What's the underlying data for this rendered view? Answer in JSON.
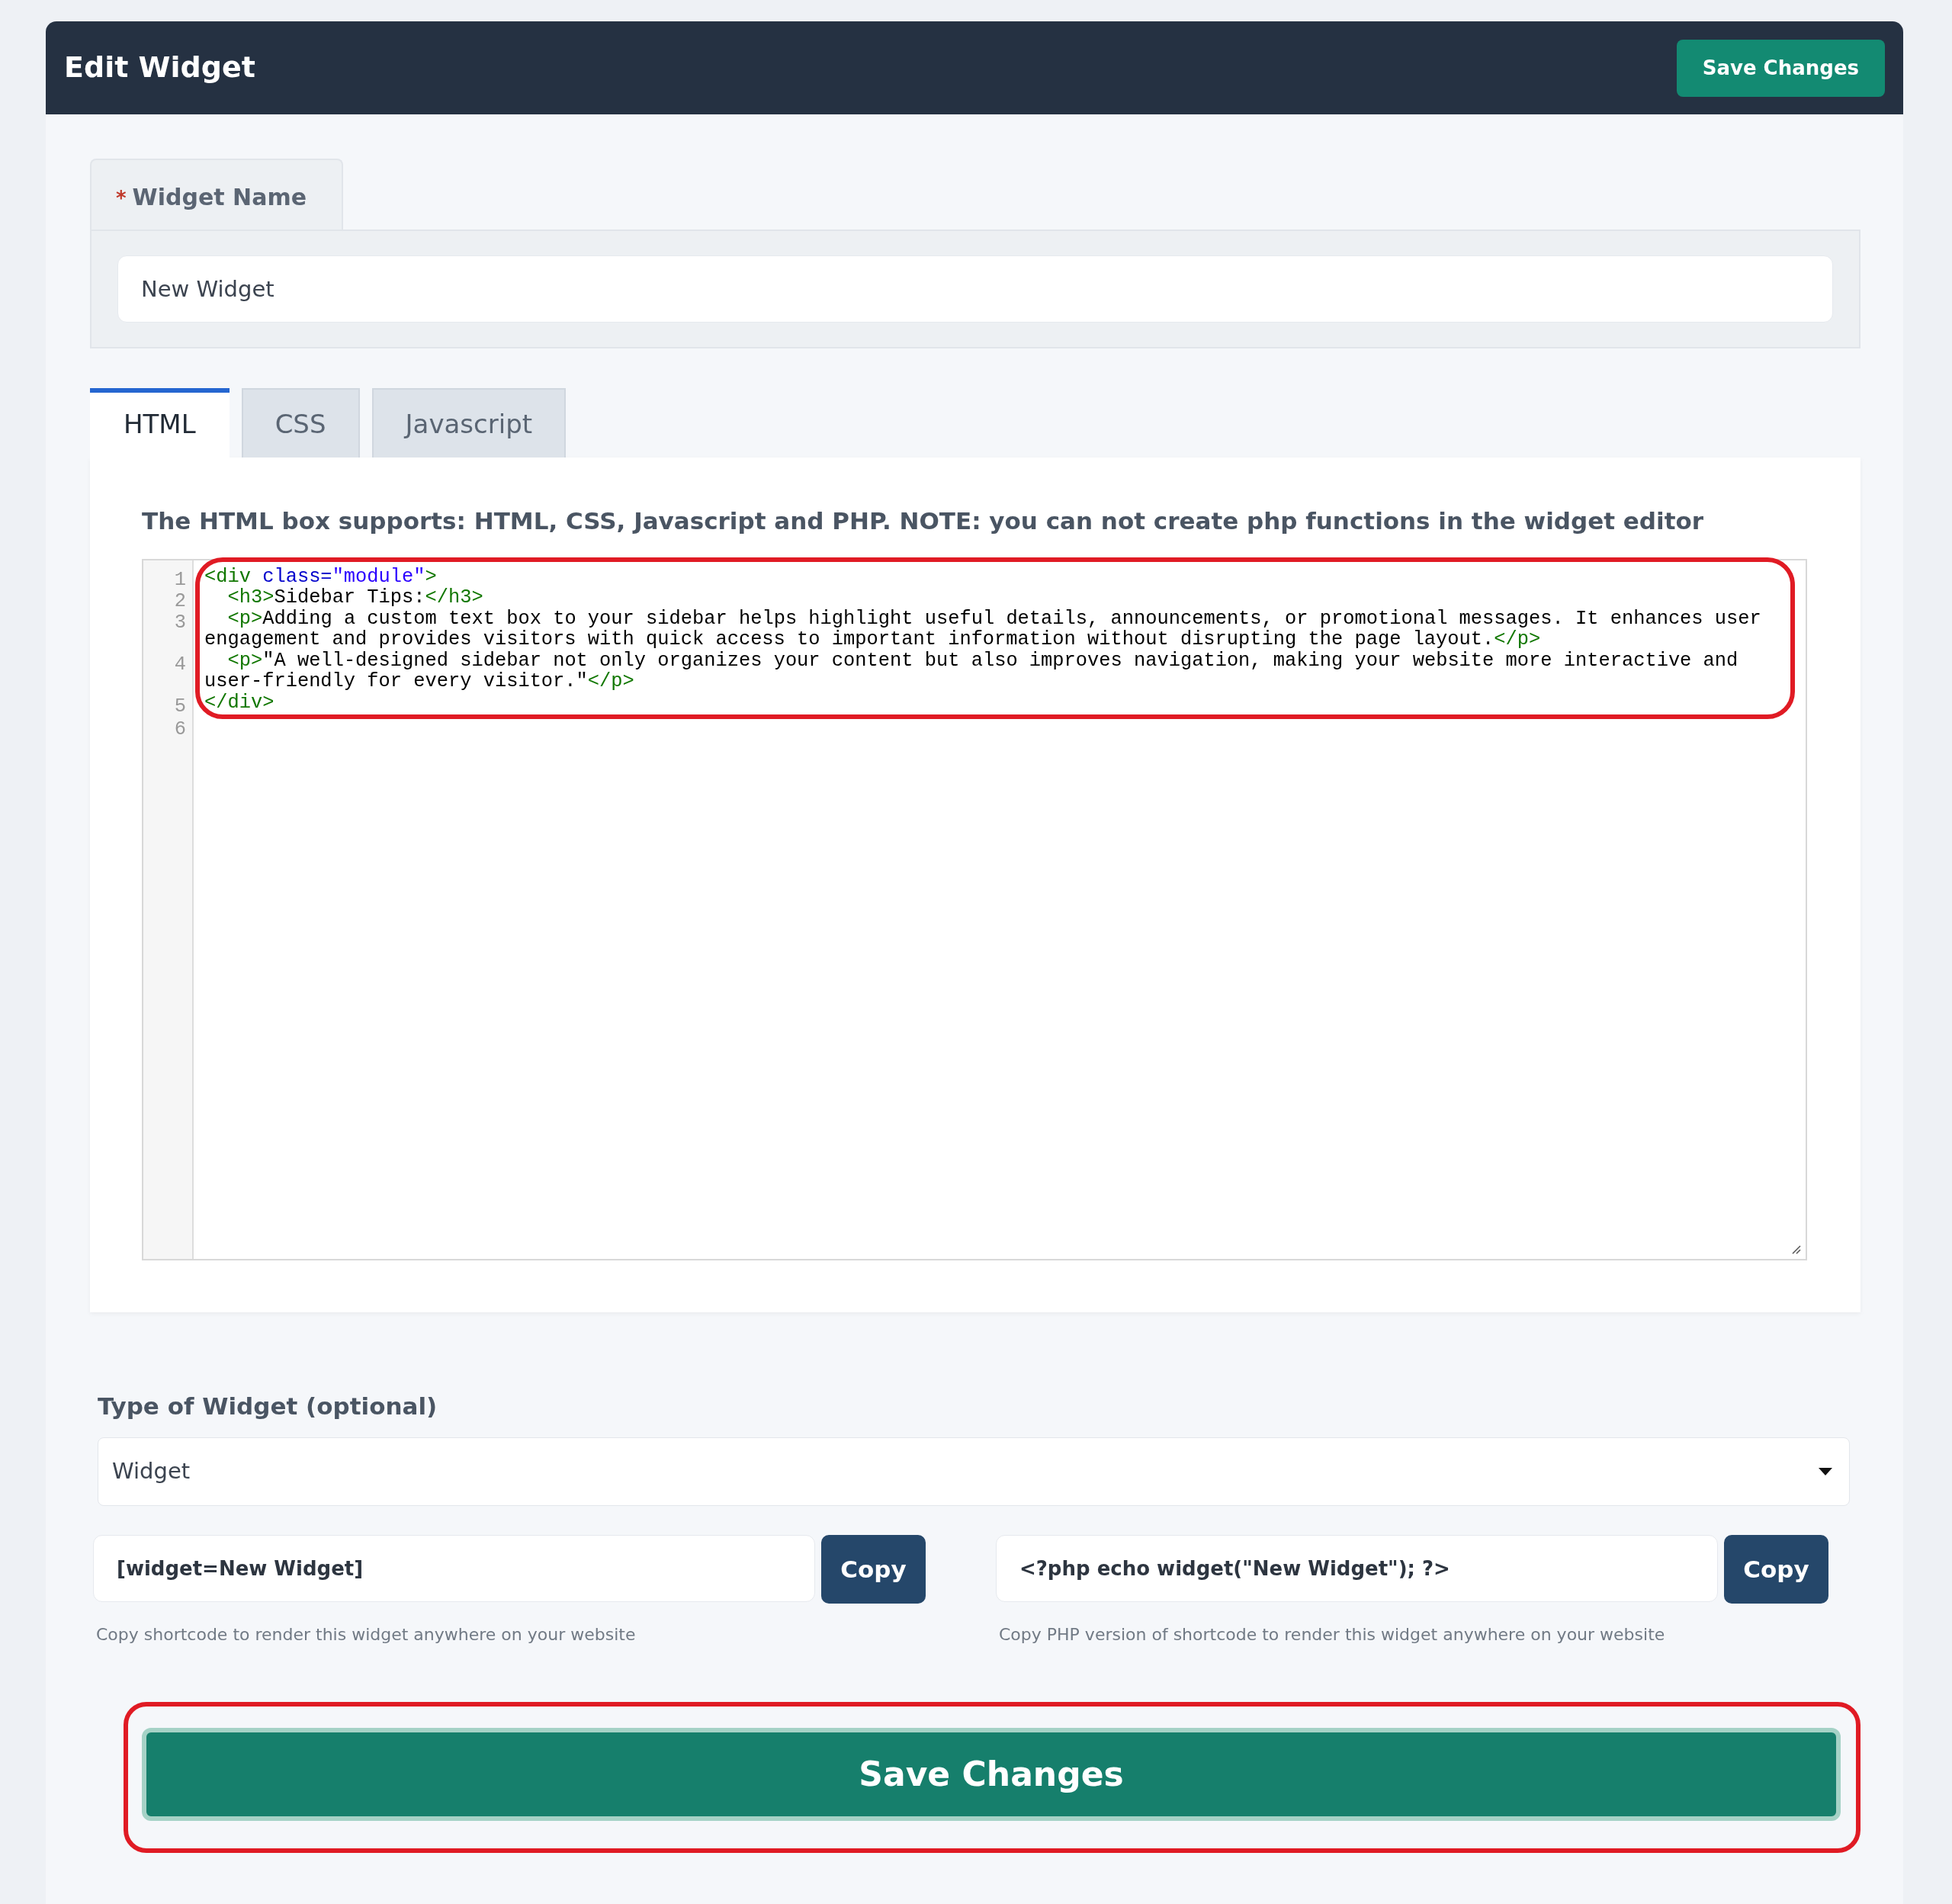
{
  "header": {
    "title": "Edit Widget",
    "save_button": "Save Changes"
  },
  "widget_name": {
    "required_mark": "*",
    "label": "Widget Name",
    "value": "New Widget"
  },
  "tabs": [
    {
      "label": "HTML",
      "selected": true
    },
    {
      "label": "CSS",
      "selected": false
    },
    {
      "label": "Javascript",
      "selected": false
    }
  ],
  "editor": {
    "note": "The HTML box supports: HTML, CSS, Javascript and PHP. NOTE: you can not create php functions in the widget editor",
    "lines": [
      {
        "number": "1",
        "text": "<div class=\"module\">"
      },
      {
        "number": "2",
        "text": "  <h3>Sidebar Tips:</h3>"
      },
      {
        "number": "3",
        "text": "  <p>Adding a custom text box to your sidebar helps highlight useful details, announcements, or promotional messages. It enhances user engagement and provides visitors with quick access to important information without disrupting the page layout.</p>"
      },
      {
        "number": "4",
        "text": "  <p>\"A well-designed sidebar not only organizes your content but also improves navigation, making your website more interactive and user-friendly for every visitor.\"</p>"
      },
      {
        "number": "5",
        "text": "</div>"
      },
      {
        "number": "6"
      }
    ]
  },
  "widget_type": {
    "label": "Type of Widget (optional)",
    "value": "Widget"
  },
  "shortcodes": [
    {
      "value": "[widget=New Widget]",
      "button": "Copy",
      "help": "Copy shortcode to render this widget anywhere on your website"
    },
    {
      "value": "<?php echo widget(\"New Widget\"); ?>",
      "button": "Copy",
      "help": "Copy PHP version of shortcode to render this widget anywhere on your website"
    }
  ],
  "save_button": "Save Changes"
}
